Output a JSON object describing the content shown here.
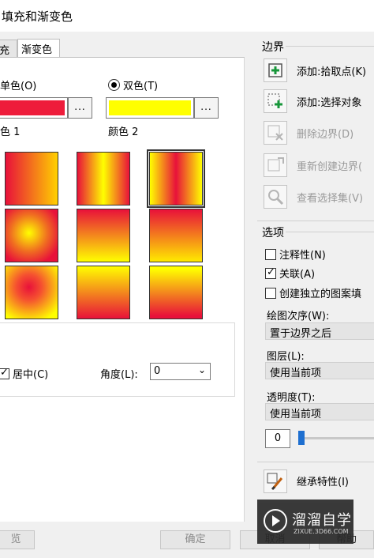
{
  "window": {
    "title": "填充和渐变色"
  },
  "tabs": [
    {
      "label": "充"
    },
    {
      "label": "渐变色"
    }
  ],
  "color": {
    "single_label": "单色(O)",
    "double_label": "双色(T)",
    "selected": "double",
    "color1_label": "色 1",
    "color2_label": "颜色 2",
    "color1_value": "#ee1c3b",
    "color2_value": "#ffff00",
    "browse_label": "..."
  },
  "gradients": [
    {
      "css": "linear-gradient(90deg,#e8113a,#ffd000)"
    },
    {
      "css": "linear-gradient(90deg,#e8113a,#ffff00 50%,#e8113a)"
    },
    {
      "css": "linear-gradient(90deg,#ffff00,#e8113a 50%,#ffff00)"
    },
    {
      "css": "radial-gradient(circle at 45% 45%,#ffff00 0%,#f07020 45%,#e8113a 80%)"
    },
    {
      "css": "linear-gradient(180deg,#e8113a,#ffff00)"
    },
    {
      "css": "linear-gradient(180deg,#e8113a,#ffea00)"
    },
    {
      "css": "radial-gradient(circle at 45% 40%,#e8113a 0%,#f55030 30%,#ffff00 85%)"
    },
    {
      "css": "linear-gradient(0deg,#e8113a,#ffff00)"
    },
    {
      "css": "linear-gradient(180deg,#ffff00 5%,#e8113a 95%)"
    }
  ],
  "orientation": {
    "centered_label": "居中(C)",
    "centered_checked": true,
    "angle_label": "角度(L):",
    "angle_value": "0"
  },
  "boundaries": {
    "group_label": "边界",
    "add_pick_label": "添加:拾取点(K)",
    "add_select_label": "添加:选择对象",
    "remove_label": "删除边界(D)",
    "recreate_label": "重新创建边界(",
    "view_label": "查看选择集(V)"
  },
  "options": {
    "group_label": "选项",
    "annotative_label": "注释性(N)",
    "annotative_checked": false,
    "associative_label": "关联(A)",
    "associative_checked": true,
    "separate_label": "创建独立的图案填",
    "separate_checked": false,
    "draw_order_label": "绘图次序(W):",
    "draw_order_value": "置于边界之后",
    "layer_label": "图层(L):",
    "layer_value": "使用当前项",
    "transparency_label": "透明度(T):",
    "transparency_value": "使用当前项",
    "transparency_amount": "0"
  },
  "inherit": {
    "label": "继承特性(I)"
  },
  "footer": {
    "preview_label": "览",
    "ok_label": "确定",
    "cancel_label": "取消",
    "help_label": "帮助"
  },
  "watermark": {
    "text": "溜溜自学",
    "sub": "ZIXUE.3D66.COM"
  }
}
